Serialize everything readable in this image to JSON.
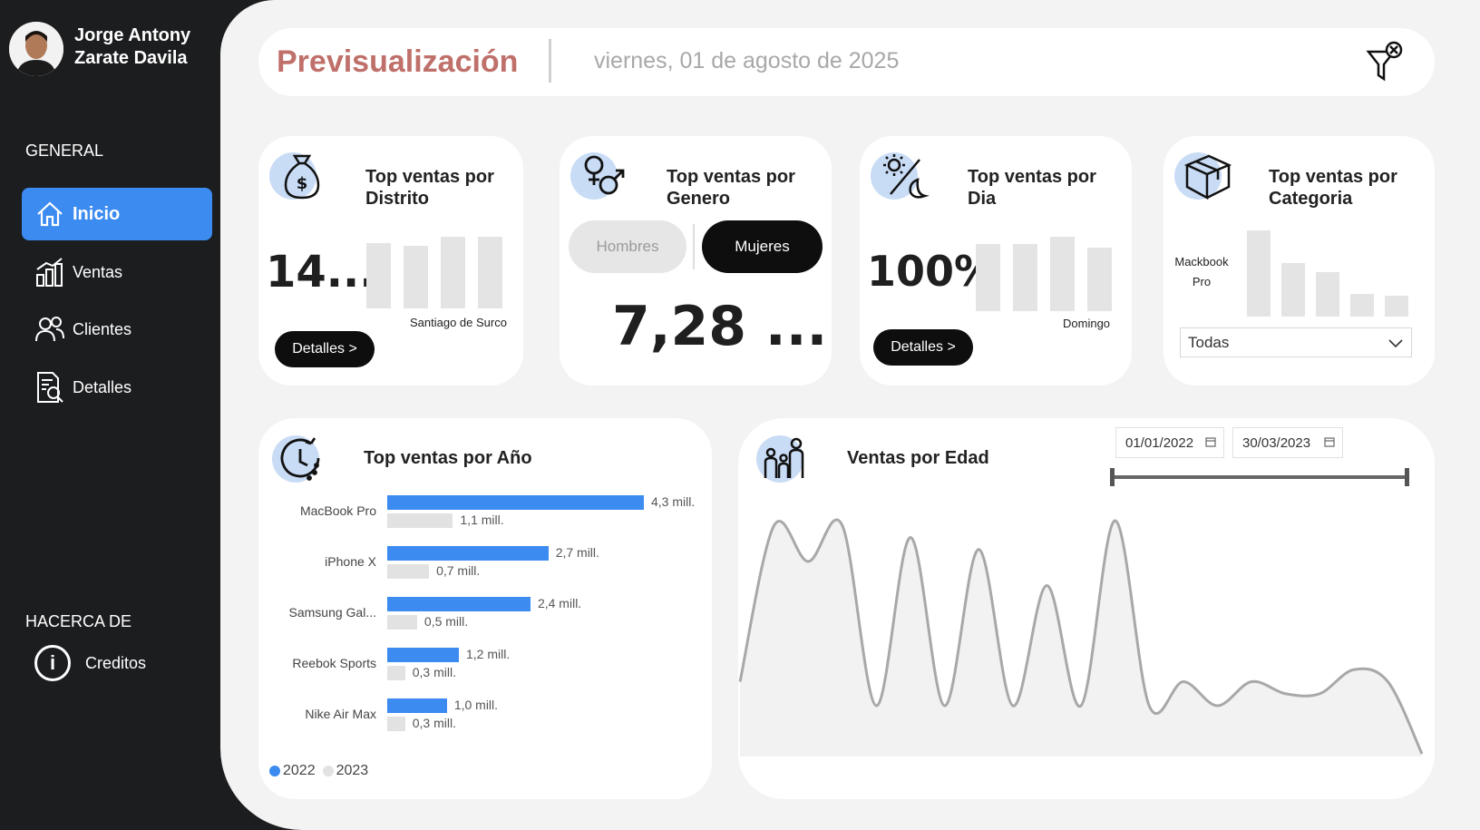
{
  "user": {
    "name_line1": "Jorge Antony",
    "name_line2": "Zarate Davila"
  },
  "sidebar": {
    "general_label": "GENERAL",
    "items": [
      {
        "label": "Inicio",
        "icon": "home-icon",
        "active": true
      },
      {
        "label": "Ventas",
        "icon": "bar-chart-icon",
        "active": false
      },
      {
        "label": "Clientes",
        "icon": "users-icon",
        "active": false
      },
      {
        "label": "Detalles",
        "icon": "document-search-icon",
        "active": false
      }
    ],
    "about_label": "HACERCA DE",
    "credits": {
      "label": "Creditos",
      "icon_glyph": "i"
    }
  },
  "header": {
    "title": "Previsualización",
    "date": "viernes, 01 de agosto de 2025",
    "filter_icon": "clear-filter-icon"
  },
  "cards": {
    "distrito": {
      "title_line1": "Top ventas por",
      "title_line2": "Distrito",
      "kpi": "14...",
      "caption": "Santiago de Surco",
      "button": "Detalles >",
      "bars": [
        0.82,
        0.78,
        0.9,
        0.9
      ]
    },
    "genero": {
      "title_line1": "Top ventas por",
      "title_line2": "Genero",
      "toggle_left": "Hombres",
      "toggle_right": "Mujeres",
      "kpi": "7,28 ..."
    },
    "dia": {
      "title_line1": "Top ventas por",
      "title_line2": "Dia",
      "kpi": "100%",
      "caption": "Domingo",
      "button": "Detalles >",
      "bars": [
        0.77,
        0.77,
        0.85,
        0.73
      ]
    },
    "categoria": {
      "title_line1": "Top ventas por",
      "title_line2": "Categoria",
      "caption_line1": "Mackbook",
      "caption_line2": "Pro",
      "select_value": "Todas",
      "bars": [
        1.0,
        0.62,
        0.52,
        0.26,
        0.24
      ]
    }
  },
  "year_chart": {
    "title": "Top ventas por Año",
    "colors": {
      "2022": "#3b8bf0",
      "2023": "#e2e2e2"
    }
  },
  "age_chart": {
    "title": "Ventas por Edad",
    "date_from": "01/01/2022",
    "date_to": "30/03/2023"
  },
  "chart_data": [
    {
      "type": "bar",
      "title": "Top ventas por Año",
      "orientation": "horizontal",
      "categories": [
        "MacBook Pro",
        "iPhone X",
        "Samsung Gal...",
        "Reebok Sports",
        "Nike Air Max"
      ],
      "series": [
        {
          "name": "2022",
          "values": [
            4.3,
            2.7,
            2.4,
            1.2,
            1.0
          ],
          "labels": [
            "4,3 mill.",
            "2,7 mill.",
            "2,4 mill.",
            "1,2 mill.",
            "1,0 mill."
          ]
        },
        {
          "name": "2023",
          "values": [
            1.1,
            0.7,
            0.5,
            0.3,
            0.3
          ],
          "labels": [
            "1,1 mill.",
            "0,7 mill.",
            "0,5 mill.",
            "0,3 mill.",
            "0,3 mill."
          ]
        }
      ],
      "legend": "bottom-left"
    },
    {
      "type": "area",
      "title": "Ventas por Edad",
      "values": [
        0.3,
        0.95,
        0.8,
        0.95,
        0.2,
        0.9,
        0.2,
        0.85,
        0.2,
        0.7,
        0.2,
        0.97,
        0.2,
        0.3,
        0.2,
        0.3,
        0.25,
        0.25,
        0.35,
        0.3,
        0.0
      ],
      "grid": false
    }
  ]
}
